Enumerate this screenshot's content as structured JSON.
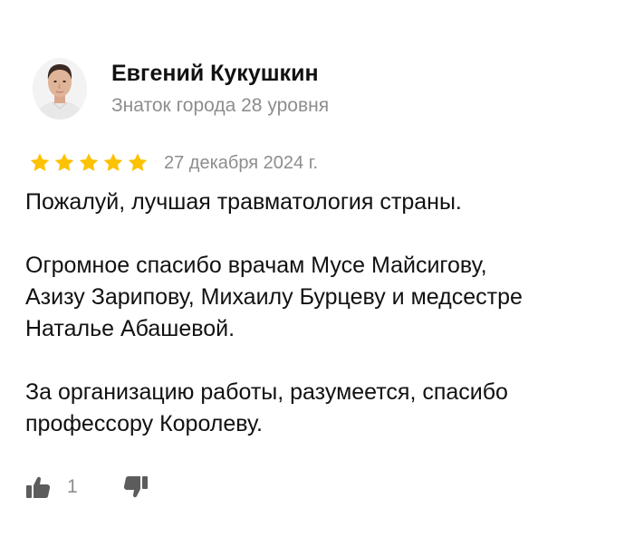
{
  "review": {
    "author": {
      "name": "Евгений Кукушкин",
      "level": "Знаток города 28 уровня"
    },
    "rating": 5,
    "rating_max": 5,
    "date": "27 декабря 2024 г.",
    "text": {
      "p1": "Пожалуй, лучшая травматология страны.",
      "p2_line1": "Огромное спасибо врачам Мусе Майсигову,",
      "p2_line2": "Азизу Зарипову, Михаилу Бурцеву и медсестре",
      "p2_line3": "Наталье Абашевой.",
      "p3_line1": "За организацию работы, разумеется, спасибо",
      "p3_line2": "профессору Королеву."
    },
    "reactions": {
      "like_icon": "thumbs-up-icon",
      "like_count": "1",
      "dislike_icon": "thumbs-down-icon"
    }
  },
  "colors": {
    "star": "#fcc203",
    "secondary_text": "#8d8d8d",
    "primary_text": "#111111"
  }
}
